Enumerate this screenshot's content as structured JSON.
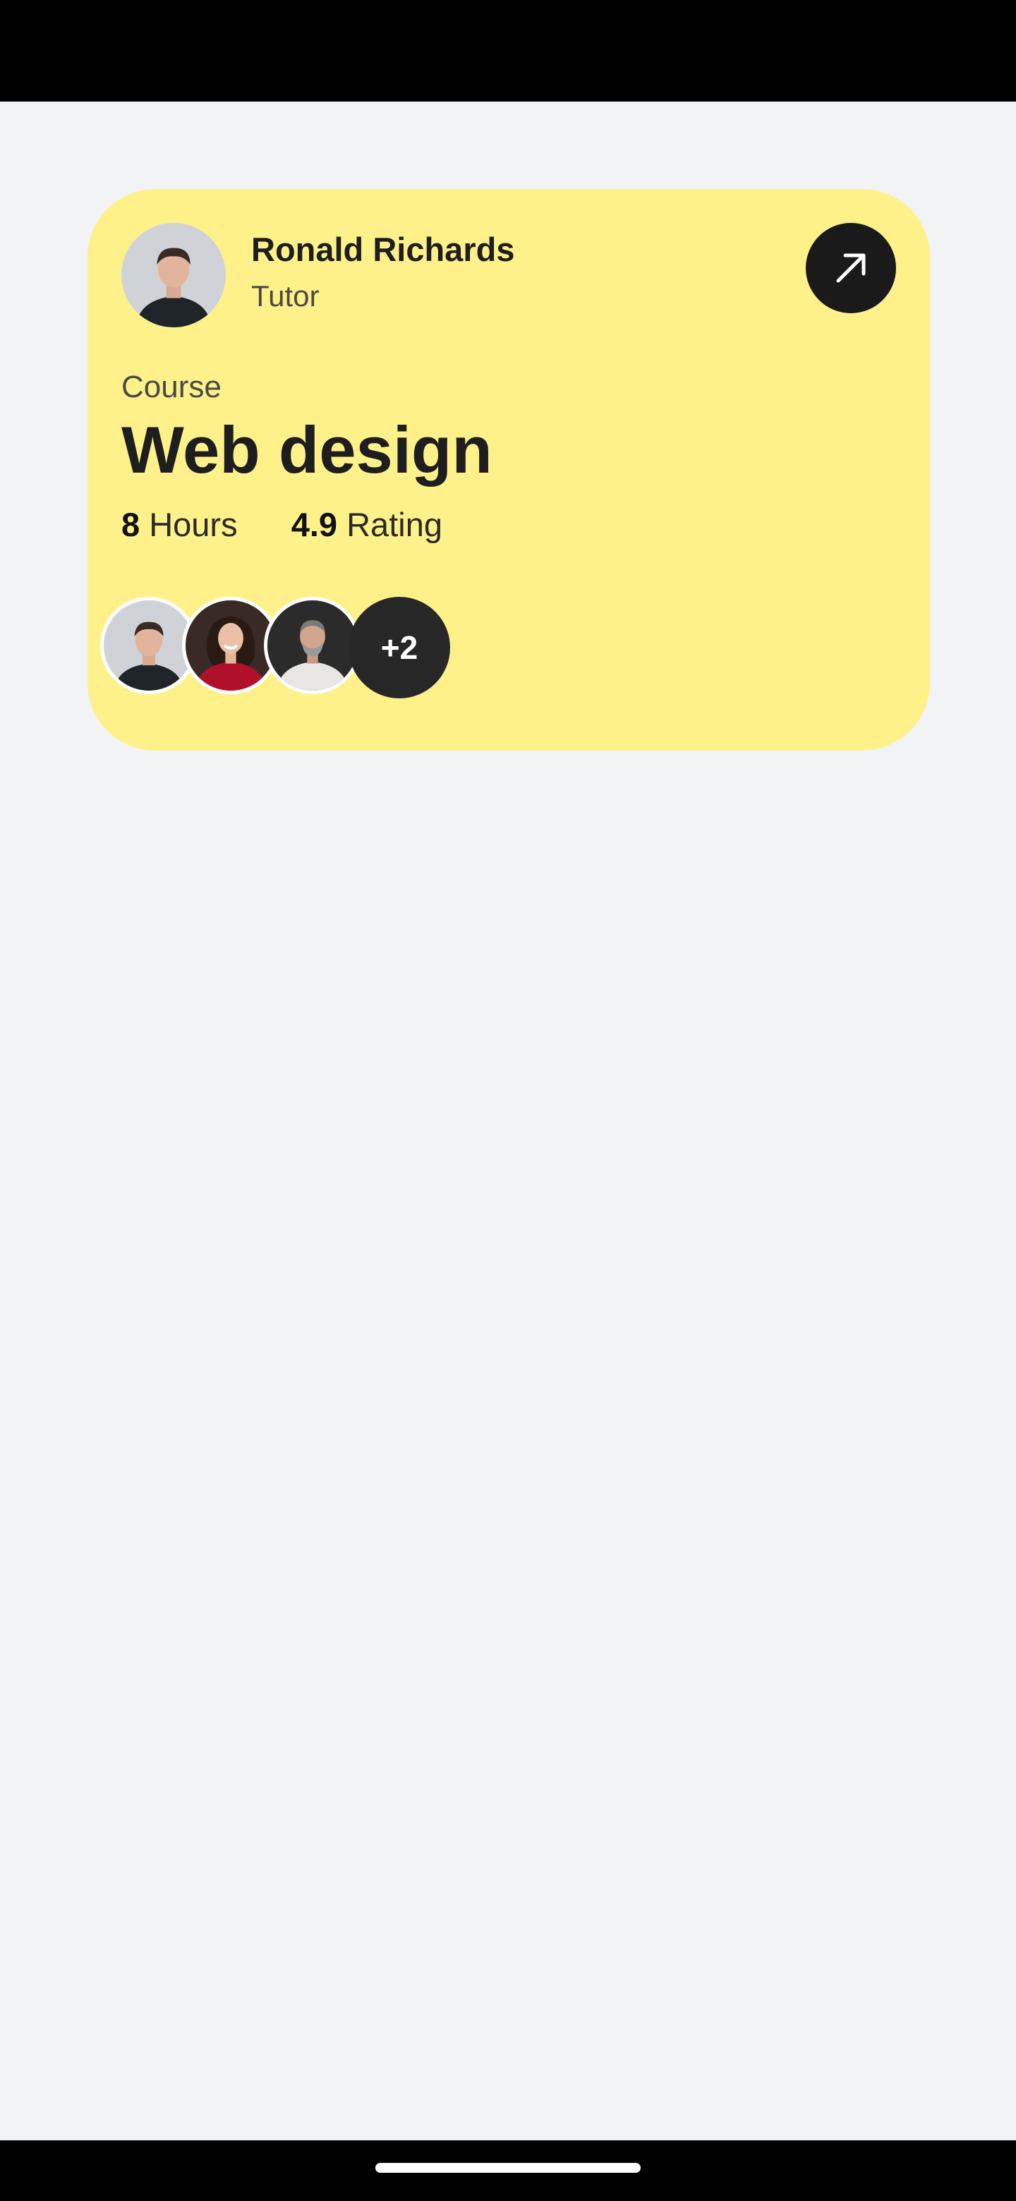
{
  "course_card": {
    "tutor": {
      "name": "Ronald Richards",
      "role": "Tutor"
    },
    "label": "Course",
    "title": "Web design",
    "hours_value": "8",
    "hours_label": "Hours",
    "rating_value": "4.9",
    "rating_label": "Rating",
    "students_more": "+2"
  },
  "colors": {
    "card_background": "#fff18a",
    "page_background": "#f2f3f5",
    "button_background": "#1a1a1a"
  },
  "icons": {
    "open_button": "arrow-up-right-icon"
  }
}
